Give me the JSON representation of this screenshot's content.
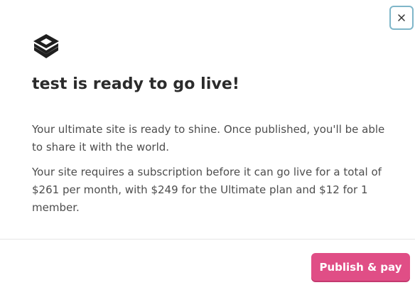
{
  "dialog": {
    "title": "test is ready to go live!",
    "paragraph_1": "Your ultimate site is ready to shine. Once published, you'll be able to share it with the world.",
    "paragraph_2": "Your site requires a subscription before it can go live for a total of $261 per month, with $249 for the Ultimate plan and $12 for 1 member.",
    "close_icon": "close-icon",
    "logo_icon": "layers-stack-icon"
  },
  "actions": {
    "publish_label": "Publish & pay"
  },
  "colors": {
    "accent": "#e04e86",
    "close_border": "#7fb6c9",
    "title_text": "#2b2b2b",
    "body_text": "#4d4d4d"
  }
}
